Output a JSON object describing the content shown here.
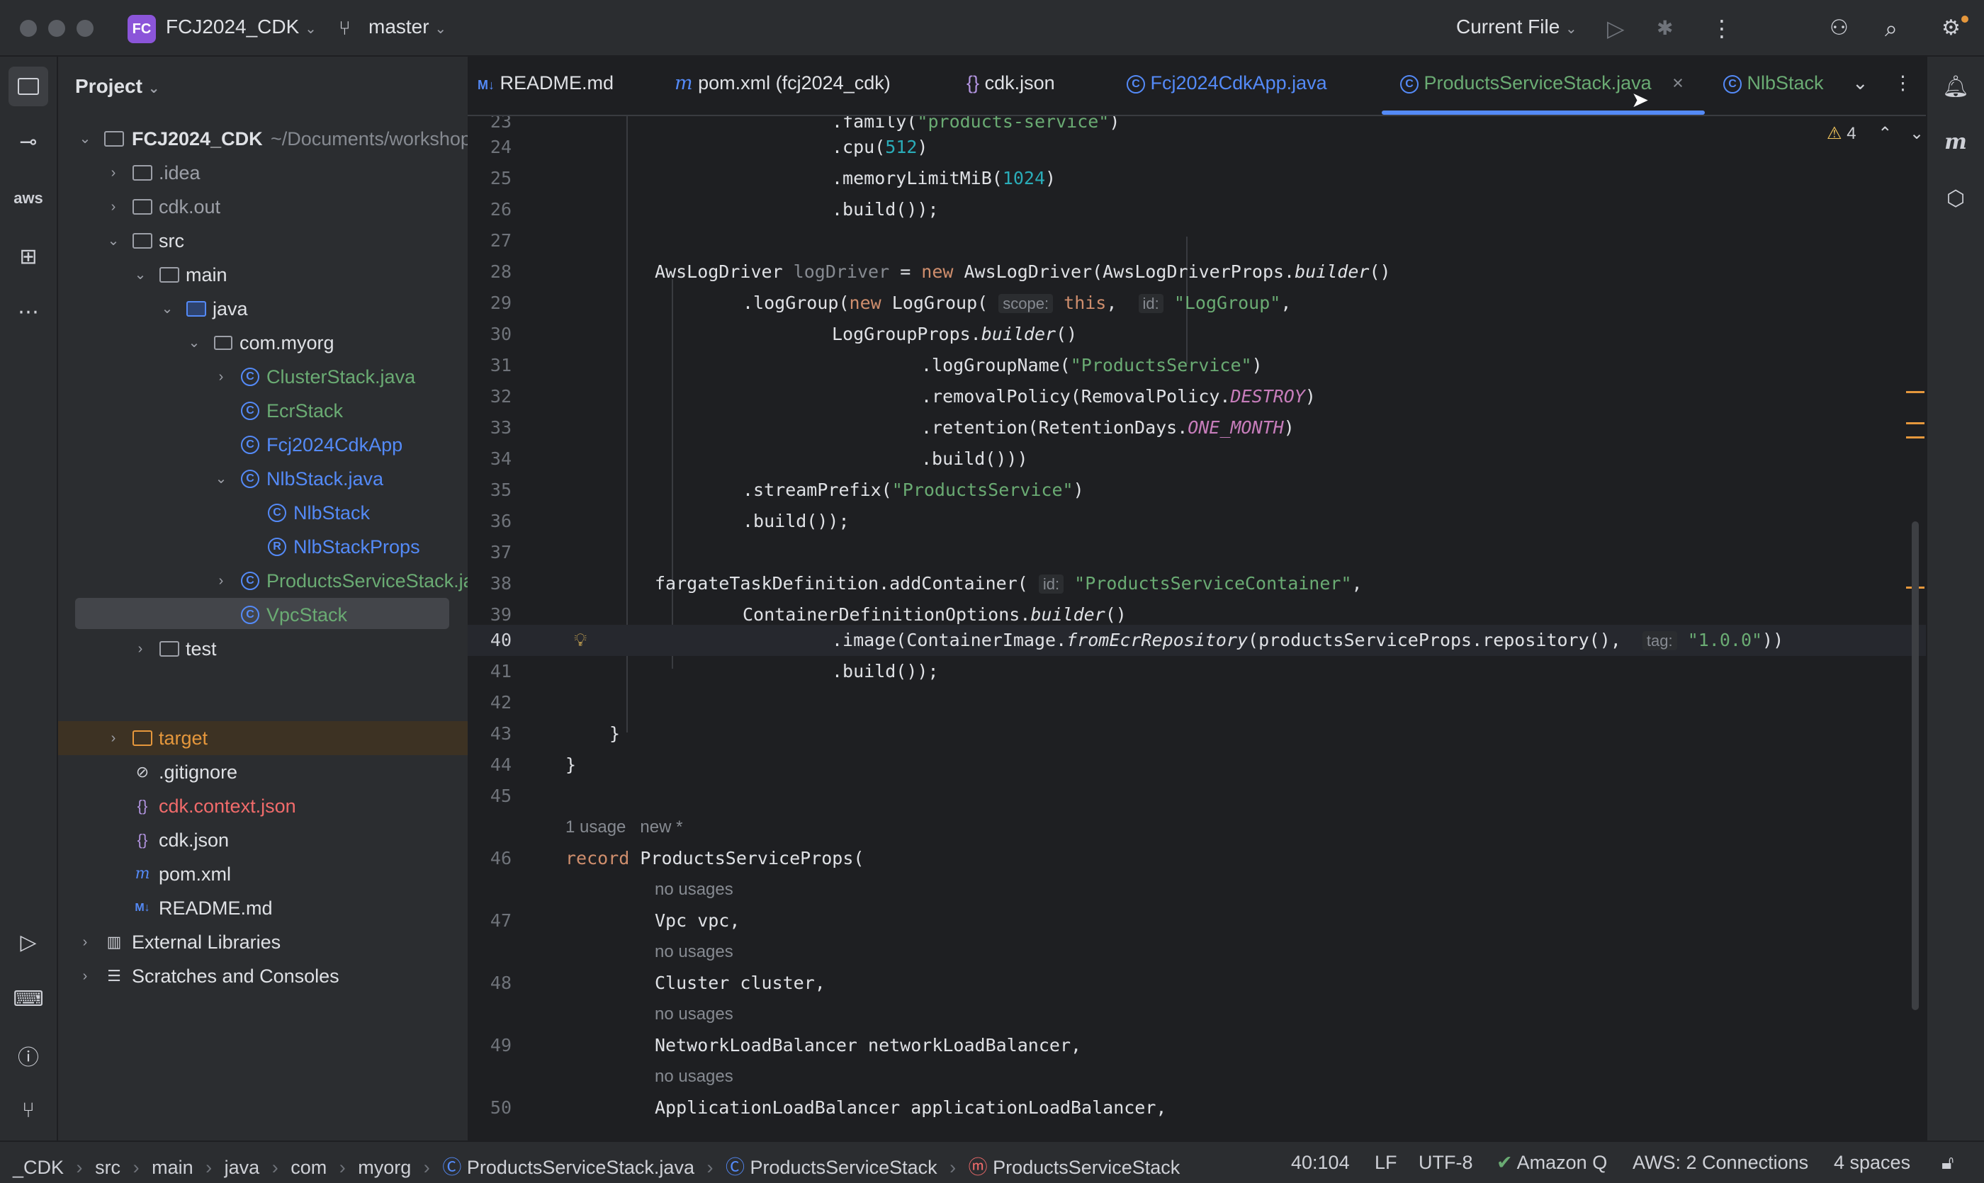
{
  "titlebar": {
    "project_badge": "FC",
    "project_name": "FCJ2024_CDK",
    "branch": "master",
    "run_config": "Current File"
  },
  "project_panel": {
    "title": "Project",
    "tree": [
      {
        "label": "FCJ2024_CDK",
        "suffix": "~/Documents/workshop",
        "type": "project-root"
      },
      {
        "label": ".idea",
        "type": "folder"
      },
      {
        "label": "cdk.out",
        "type": "folder"
      },
      {
        "label": "src",
        "type": "folder"
      },
      {
        "label": "main",
        "type": "folder"
      },
      {
        "label": "java",
        "type": "folder"
      },
      {
        "label": "com.myorg",
        "type": "package"
      },
      {
        "label": "ClusterStack.java",
        "type": "class"
      },
      {
        "label": "EcrStack",
        "type": "class"
      },
      {
        "label": "Fcj2024CdkApp",
        "type": "class"
      },
      {
        "label": "NlbStack.java",
        "type": "class"
      },
      {
        "label": "NlbStack",
        "type": "class"
      },
      {
        "label": "NlbStackProps",
        "type": "record"
      },
      {
        "label": "ProductsServiceStack.java",
        "type": "class"
      },
      {
        "label": "VpcStack",
        "type": "class"
      },
      {
        "label": "test",
        "type": "folder"
      },
      {
        "label": "target",
        "type": "folder"
      },
      {
        "label": ".gitignore",
        "type": "file"
      },
      {
        "label": "cdk.context.json",
        "type": "json"
      },
      {
        "label": "cdk.json",
        "type": "json"
      },
      {
        "label": "pom.xml",
        "type": "maven"
      },
      {
        "label": "README.md",
        "type": "markdown"
      },
      {
        "label": "External Libraries",
        "type": "libraries"
      },
      {
        "label": "Scratches and Consoles",
        "type": "scratches"
      }
    ]
  },
  "tabs": [
    {
      "label": "README.md",
      "icon": "M↓"
    },
    {
      "label": "pom.xml (fcj2024_cdk)",
      "icon": "m"
    },
    {
      "label": "cdk.json",
      "icon": "{}"
    },
    {
      "label": "Fcj2024CdkApp.java",
      "icon": "C"
    },
    {
      "label": "ProductsServiceStack.java",
      "icon": "C",
      "active": true
    },
    {
      "label": "NlbStack",
      "icon": "C"
    }
  ],
  "editor": {
    "warnings_count": "4",
    "lines": {
      "23": ".family(\"products-service\")",
      "24": ".cpu(512)",
      "25": ".memoryLimitMiB(1024)",
      "26": ".build());",
      "28": "AwsLogDriver logDriver = new AwsLogDriver(AwsLogDriverProps.builder()",
      "29": ".logGroup(new LogGroup( scope: this,  id: \"LogGroup\",",
      "30": "LogGroupProps.builder()",
      "31": ".logGroupName(\"ProductsService\")",
      "32": ".removalPolicy(RemovalPolicy.DESTROY)",
      "33": ".retention(RetentionDays.ONE_MONTH)",
      "34": ".build()))",
      "35": ".streamPrefix(\"ProductsService\")",
      "36": ".build());",
      "38": "fargateTaskDefinition.addContainer( id: \"ProductsServiceContainer\",",
      "39": "ContainerDefinitionOptions.builder()",
      "40": ".image(ContainerImage.fromEcrRepository(productsServiceProps.repository(),  tag: \"1.0.0\"))",
      "41": ".build());",
      "43": "}",
      "44": "}",
      "46": "record ProductsServiceProps(",
      "47": "Vpc vpc,",
      "48": "Cluster cluster,",
      "49": "NetworkLoadBalancer networkLoadBalancer,",
      "50": "ApplicationLoadBalancer applicationLoadBalancer,"
    },
    "lens_usage": "1 usage",
    "lens_new": "new *",
    "no_usages": "no usages"
  },
  "statusbar": {
    "breadcrumb": [
      "_CDK",
      "src",
      "main",
      "java",
      "com",
      "myorg",
      "ProductsServiceStack.java",
      "ProductsServiceStack",
      "ProductsServiceStack"
    ],
    "position": "40:104",
    "line_sep": "LF",
    "encoding": "UTF-8",
    "amazon_q": "Amazon Q",
    "aws": "AWS: 2 Connections",
    "indent": "4 spaces"
  },
  "colors": {
    "accent": "#548af7",
    "keyword": "#cf8e6d",
    "string": "#6aab73",
    "number": "#2aacb8",
    "constant": "#c77dbb",
    "warning": "#f2c55c"
  }
}
